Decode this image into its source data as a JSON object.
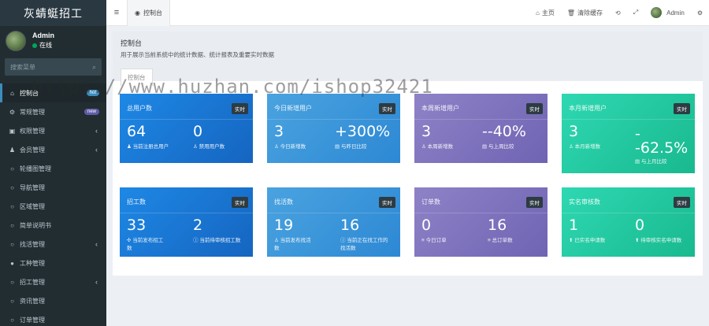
{
  "app": {
    "title": "灰蜻蜓招工"
  },
  "user": {
    "name": "Admin",
    "status": "在线"
  },
  "search": {
    "placeholder": "搜索菜单"
  },
  "sidebar": {
    "items": [
      {
        "label": "控制台",
        "icon": "home-icon",
        "badge": "hot"
      },
      {
        "label": "常规管理",
        "icon": "cogs-icon",
        "badge": "new"
      },
      {
        "label": "权限管理",
        "icon": "group-icon",
        "chevron": true
      },
      {
        "label": "会员管理",
        "icon": "user-icon",
        "chevron": true
      },
      {
        "label": "轮播图管理",
        "icon": "circle-icon"
      },
      {
        "label": "导航管理",
        "icon": "circle-icon"
      },
      {
        "label": "区域管理",
        "icon": "circle-icon"
      },
      {
        "label": "简单说明书",
        "icon": "circle-icon"
      },
      {
        "label": "找活管理",
        "icon": "circle-icon",
        "chevron": true
      },
      {
        "label": "工种管理",
        "icon": "info-icon"
      },
      {
        "label": "招工管理",
        "icon": "circle-icon",
        "chevron": true
      },
      {
        "label": "资讯管理",
        "icon": "circle-icon"
      },
      {
        "label": "订单管理",
        "icon": "circle-icon"
      }
    ]
  },
  "header": {
    "tab_label": "控制台",
    "home_label": "主页",
    "clear_cache_label": "清除缓存",
    "admin_label": "Admin"
  },
  "panel": {
    "title": "控制台",
    "subtitle": "用于展示当前系统中的统计数据、统计报表及重要实时数据",
    "tab": "控制台"
  },
  "cards": [
    {
      "title": "总用户数",
      "tag": "实时",
      "num1": "64",
      "sub1": "当前注册总用户",
      "num2": "0",
      "sub2": "禁用用户数"
    },
    {
      "title": "今日新增用户",
      "tag": "实时",
      "num1": "3",
      "sub1": "今日新增数",
      "num2": "+300%",
      "sub2": "与昨日比较"
    },
    {
      "title": "本周新增用户",
      "tag": "实时",
      "num1": "3",
      "sub1": "本周新增数",
      "num2": "--40%",
      "sub2": "与上周比较"
    },
    {
      "title": "本月新增用户",
      "tag": "实时",
      "num1": "3",
      "sub1": "本月新增数",
      "num2": "-\n-62.5%",
      "sub2": "与上月比较"
    },
    {
      "title": "招工数",
      "tag": "实时",
      "num1": "33",
      "sub1": "当前发布招工\n数",
      "num2": "2",
      "sub2": "当前待审核招工数"
    },
    {
      "title": "找活数",
      "tag": "实时",
      "num1": "19",
      "sub1": "当前发布找活\n数",
      "num2": "16",
      "sub2": "当前正在找工作的\n找活数"
    },
    {
      "title": "订单数",
      "tag": "实时",
      "num1": "0",
      "sub1": "今日订单",
      "num2": "16",
      "sub2": "总订单数"
    },
    {
      "title": "实名审核数",
      "tag": "实时",
      "num1": "1",
      "sub1": "已实名申请数",
      "num2": "0",
      "sub2": "待审核实名申请数"
    }
  ],
  "watermark": "https://www.huzhan.com/ishop32421",
  "colors": {
    "sidebar": "#222d32",
    "accent": "#3c8dbc",
    "blue": "#1e88e5",
    "purple": "#7d72bd",
    "green": "#22c9a0"
  }
}
